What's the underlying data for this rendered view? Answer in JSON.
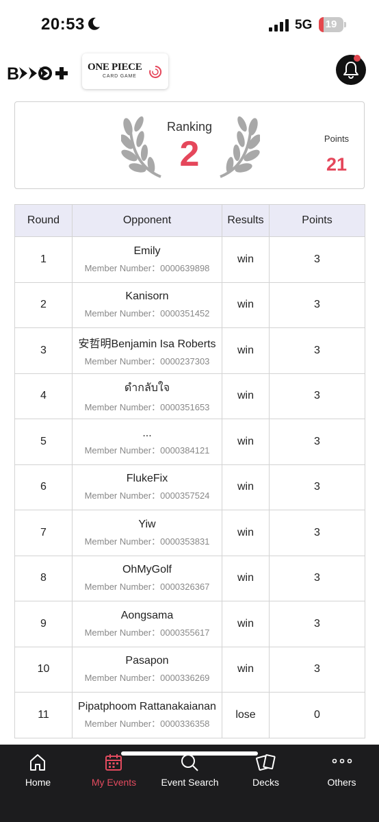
{
  "status_bar": {
    "time": "20:53",
    "network": "5G",
    "battery": "19",
    "battery_level": 0.19,
    "icons": [
      "moon-icon",
      "signal-icon",
      "battery-icon"
    ]
  },
  "header": {
    "brand_logo_text": "BCG+",
    "game_logo_title": "ONE PIECE",
    "game_logo_subtitle": "CARD GAME",
    "icons": [
      "bell-icon"
    ],
    "notification_dot": true
  },
  "ranking": {
    "label": "Ranking",
    "value": "2",
    "points_label": "Points",
    "points_value": "21"
  },
  "table": {
    "headers": [
      "Round",
      "Opponent",
      "Results",
      "Points"
    ],
    "member_prefix": "Member Number：",
    "rows": [
      {
        "round": "1",
        "name": "Emily",
        "member": "Member Number：0000639898",
        "result": "win",
        "points": "3"
      },
      {
        "round": "2",
        "name": "Kanisorn",
        "member": "Member Number：0000351452",
        "result": "win",
        "points": "3"
      },
      {
        "round": "3",
        "name": "安哲明Benjamin Isa Roberts",
        "member": "Member Number：0000237303",
        "result": "win",
        "points": "3"
      },
      {
        "round": "4",
        "name": "ดำกลับใจ",
        "member": "Member Number：0000351653",
        "result": "win",
        "points": "3"
      },
      {
        "round": "5",
        "name": "...",
        "member": "Member Number：0000384121",
        "result": "win",
        "points": "3"
      },
      {
        "round": "6",
        "name": "FlukeFix",
        "member": "Member Number：0000357524",
        "result": "win",
        "points": "3"
      },
      {
        "round": "7",
        "name": "Yiw",
        "member": "Member Number：0000353831",
        "result": "win",
        "points": "3"
      },
      {
        "round": "8",
        "name": "OhMyGolf",
        "member": "Member Number：0000326367",
        "result": "win",
        "points": "3"
      },
      {
        "round": "9",
        "name": "Aongsama",
        "member": "Member Number：0000355617",
        "result": "win",
        "points": "3"
      },
      {
        "round": "10",
        "name": "Pasapon",
        "member": "Member Number：0000336269",
        "result": "win",
        "points": "3"
      },
      {
        "round": "11",
        "name": "Pipatphoom Rattanakaianan",
        "member": "Member Number：0000336358",
        "result": "lose",
        "points": "0"
      }
    ]
  },
  "tab_bar": {
    "tabs": [
      {
        "label": "Home",
        "icon": "home-icon",
        "active": false
      },
      {
        "label": "My Events",
        "icon": "calendar-icon",
        "active": true
      },
      {
        "label": "Event Search",
        "icon": "search-icon",
        "active": false
      },
      {
        "label": "Decks",
        "icon": "cards-icon",
        "active": false
      },
      {
        "label": "Others",
        "icon": "more-icon",
        "active": false
      }
    ]
  },
  "colors": {
    "accent": "#e5475b",
    "tab_active": "#e34b5f",
    "header_row_bg": "#eaeaf6",
    "tab_bar_bg": "#1c1c1e",
    "battery_low": "#e5484d"
  }
}
